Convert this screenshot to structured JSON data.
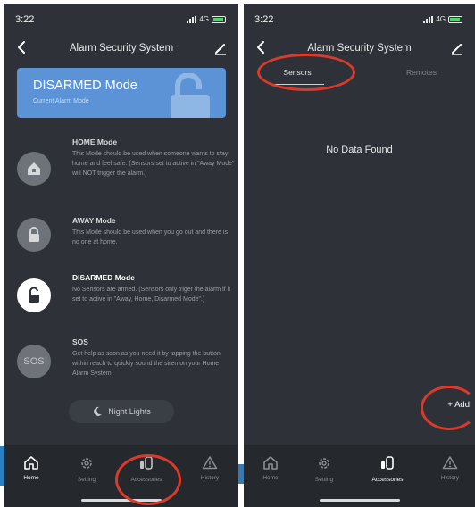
{
  "status": {
    "time": "3:22",
    "network": "4G"
  },
  "left_screen": {
    "title": "Alarm Security System",
    "banner": {
      "title": "DISARMED Mode",
      "subtitle": "Current Alarm Mode"
    },
    "modes": [
      {
        "name": "HOME Mode",
        "description": "This Mode should be used when someone wants to stay home and feel safe. (Sensors set to active in \"Away Mode\" will NOT trigger the alarm.)",
        "icon": "home-lock-icon"
      },
      {
        "name": "AWAY Mode",
        "description": "This Mode should be used when you go out and there is no one at home.",
        "icon": "lock-icon"
      },
      {
        "name": "DISARMED Mode",
        "description": "No Sensors are armed. (Sensors only triger the alarm if it set to active in \"Away, Home, Disarmed Mode\".)",
        "icon": "unlock-icon"
      },
      {
        "name": "SOS",
        "description": "Get help as soon as you need it by tapping the button within reach to quickly sound the siren on your Home Alarm System.",
        "icon_text": "SOS"
      }
    ],
    "night_lights_label": "Night Lights",
    "tabs": [
      {
        "label": "Home",
        "icon": "home-icon"
      },
      {
        "label": "Setting",
        "icon": "gear-icon"
      },
      {
        "label": "Accessories",
        "icon": "sensor-icon"
      },
      {
        "label": "History",
        "icon": "warning-triangle-icon"
      }
    ],
    "active_tab": "Home"
  },
  "right_screen": {
    "title": "Alarm Security System",
    "segments": [
      "Sensors",
      "Remotes"
    ],
    "active_segment": "Sensors",
    "empty_message": "No Data Found",
    "add_label": "+ Add",
    "tabs": [
      {
        "label": "Home",
        "icon": "home-icon"
      },
      {
        "label": "Setting",
        "icon": "gear-icon"
      },
      {
        "label": "Accessories",
        "icon": "sensor-icon"
      },
      {
        "label": "History",
        "icon": "warning-triangle-icon"
      }
    ],
    "active_tab": "Accessories"
  },
  "colors": {
    "background": "#2e3238",
    "banner": "#5b93d6",
    "annotation": "#d83a2c",
    "tabbar": "#25282d"
  }
}
